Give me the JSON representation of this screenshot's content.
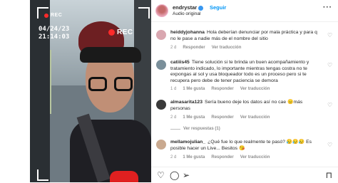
{
  "video": {
    "rec_small": "REC",
    "rec_big": "REC",
    "date": "04/24/23",
    "time": "21:14:03"
  },
  "header": {
    "username": "endrystar",
    "follow": "Seguir",
    "audio": "Audio original",
    "more": "···"
  },
  "comments": [
    {
      "user": "heiddyjohanna",
      "text": "Hola deberían denunciar por mala práctica y para q no le pase a nadie más de el nombre del sitio",
      "time": "2 d",
      "likes": "",
      "reply": "Responder",
      "translate": "Ver traducción",
      "avatar_color": "#d9a7b0"
    },
    {
      "user": "catiiis45",
      "text": "Tiene solución si te brinda un buen acompañamiento y tratamiento indicado, lo importante mientras tengas costra no te expongas al sol y usa bloqueador todo es un proceso pero si te recupera pero debe de tener paciencia se demora",
      "time": "1 d",
      "likes": "1 Me gusta",
      "reply": "Responder",
      "translate": "Ver traducción",
      "avatar_color": "#7a8f9a"
    },
    {
      "user": "almasarita123",
      "text": "Sería bueno deje los datos así no cae 😑más personas",
      "time": "2 d",
      "likes": "1 Me gusta",
      "reply": "Responder",
      "translate": "Ver traducción",
      "replies": "Ver respuestas (1)",
      "avatar_color": "#3a3a3a"
    },
    {
      "user": "mellamojulian_",
      "text": "¿Qué fue lo que realmente te pasó? 😥😥😥 Es posible hacer un Live... Besitos 😘",
      "time": "2 d",
      "likes": "1 Me gusta",
      "reply": "Responder",
      "translate": "Ver traducción",
      "avatar_color": "#c9a98f"
    }
  ],
  "actions": {
    "like_icon": "heart-icon",
    "comment_icon": "comment-icon",
    "share_icon": "send-icon",
    "save_icon": "bookmark-icon"
  },
  "colors": {
    "accent": "#0095f6",
    "muted": "#8e8e8e",
    "rec": "#ff2a2a"
  }
}
